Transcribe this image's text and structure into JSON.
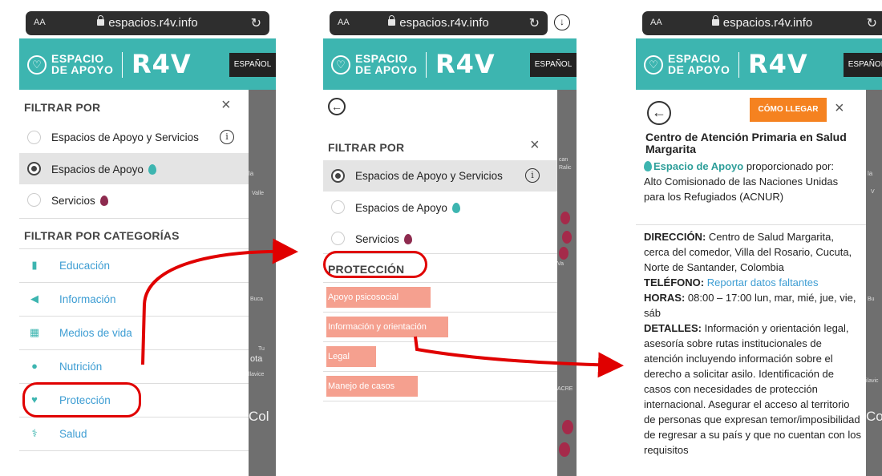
{
  "browser": {
    "aa": "AA",
    "url": "espacios.r4v.info",
    "reload_icon": "reload-icon",
    "download_icon": "download-icon"
  },
  "header": {
    "logo_line1": "ESPACIO",
    "logo_line2": "DE APOYO",
    "brand": "R4V",
    "language_button": "ESPAÑOL"
  },
  "screen1": {
    "filter_title": "FILTRAR POR",
    "filters": [
      {
        "label": "Espacios de Apoyo y Servicios",
        "selected": false
      },
      {
        "label": "Espacios de Apoyo",
        "selected": true
      },
      {
        "label": "Servicios",
        "selected": false
      }
    ],
    "categories_title": "FILTRAR POR CATEGORÍAS",
    "categories": [
      {
        "label": "Educación",
        "icon": "book-icon"
      },
      {
        "label": "Información",
        "icon": "megaphone-icon"
      },
      {
        "label": "Medios de vida",
        "icon": "store-icon"
      },
      {
        "label": "Nutrición",
        "icon": "bowl-icon"
      },
      {
        "label": "Protección",
        "icon": "hands-icon"
      },
      {
        "label": "Salud",
        "icon": "caduceus-icon"
      }
    ],
    "map_labels": [
      "la",
      "Valle",
      "Buca",
      "Tu",
      "ota",
      "llavice",
      "Col"
    ]
  },
  "screen2": {
    "filter_title": "FILTRAR POR",
    "filters": [
      {
        "label": "Espacios de Apoyo y Servicios",
        "selected": true
      },
      {
        "label": "Espacios de Apoyo",
        "selected": false
      },
      {
        "label": "Servicios",
        "selected": false
      }
    ],
    "category_title": "PROTECCIÓN",
    "items": [
      "Apoyo psicosocial",
      "Información y orientación",
      "Legal",
      "Manejo de casos"
    ],
    "map_labels": [
      "can",
      "Ralic",
      "Va",
      "ACRE"
    ]
  },
  "screen3": {
    "route_button": "CÓMO LLEGAR",
    "title": "Centro de Atención Primaria en Salud Margarita",
    "type_label": "Espacio de Apoyo",
    "provided_by": " proporcionado por:",
    "provider": "Alto Comisionado de las Naciones Unidas para los Refugiados (ACNUR)",
    "address_label": "DIRECCIÓN:",
    "address": " Centro de Salud Margarita, cerca del comedor, Villa del Rosario, Cucuta, Norte de Santander, Colombia",
    "phone_label": "TELÉFONO:",
    "phone": "Reportar datos faltantes",
    "hours_label": "HORAS:",
    "hours": " 08:00 – 17:00 lun, mar, mié, jue, vie, sáb",
    "details_label": "DETALLES:",
    "details": " Información y orientación legal, asesoría sobre rutas institucionales de atención incluyendo información sobre el derecho a solicitar asilo. Identificación de casos con necesidades de protección internacional. Asegurar el acceso al territorio de personas que expresan temor/imposibilidad de regresar a su país y que no cuentan con los requisitos",
    "map_labels": [
      "la",
      "V",
      "Bu",
      "ilavic",
      "Co"
    ]
  },
  "colors": {
    "teal": "#3db5b0",
    "annotation_red": "#e00000",
    "highlight": "#f5a08f",
    "route_orange": "#f58220",
    "link_blue": "#3d9dd3",
    "map_gray": "#6f6f6f"
  }
}
